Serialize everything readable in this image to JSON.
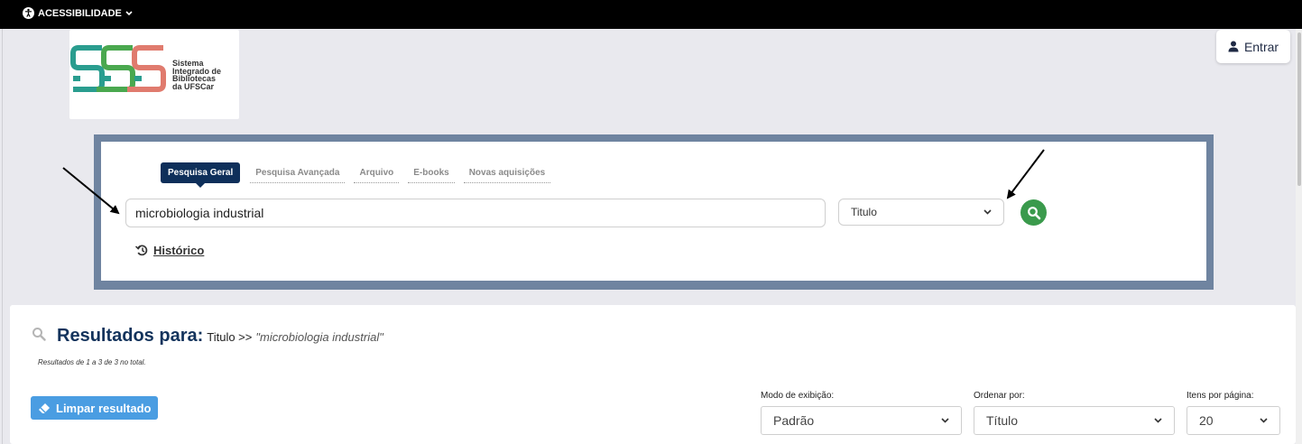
{
  "topbar": {
    "accessibility_label": "ACESSIBILIDADE"
  },
  "logo": {
    "text": "Sistema\nIntegrado de\nBibliotecas\nda UFSCar"
  },
  "header": {
    "login_label": "Entrar"
  },
  "search": {
    "tabs": [
      {
        "label": "Pesquisa Geral",
        "active": true
      },
      {
        "label": "Pesquisa Avançada",
        "active": false
      },
      {
        "label": "Arquivo",
        "active": false
      },
      {
        "label": "E-books",
        "active": false
      },
      {
        "label": "Novas aquisições",
        "active": false
      }
    ],
    "query_value": "microbiologia industrial",
    "field_selected": "Titulo",
    "history_label": "Histórico"
  },
  "results": {
    "heading": "Resultados para:",
    "field": "Titulo >>",
    "query": "\"microbiologia industrial\"",
    "count_text": "Resultados de 1 a 3 de 3 no total.",
    "clear_label": "Limpar resultado",
    "view_mode": {
      "label": "Modo de exibição:",
      "value": "Padrão"
    },
    "sort": {
      "label": "Ordenar por:",
      "value": "Título"
    },
    "per_page": {
      "label": "Itens por página:",
      "value": "20"
    }
  },
  "colors": {
    "topbar": "#000000",
    "frame": "#6f84a0",
    "active_tab": "#0e2f5a",
    "search_button": "#3a9a4c",
    "heading": "#13335c",
    "clear_button": "#4a9de2",
    "logo_teal": "#2a9d8f",
    "logo_green": "#4aa84f",
    "logo_red": "#e07b6e"
  },
  "icons": {
    "accessibility": "accessibility-icon",
    "user": "user-icon",
    "search": "search-icon",
    "history": "history-icon",
    "eraser": "eraser-icon",
    "chevron": "chevron-down-icon"
  }
}
